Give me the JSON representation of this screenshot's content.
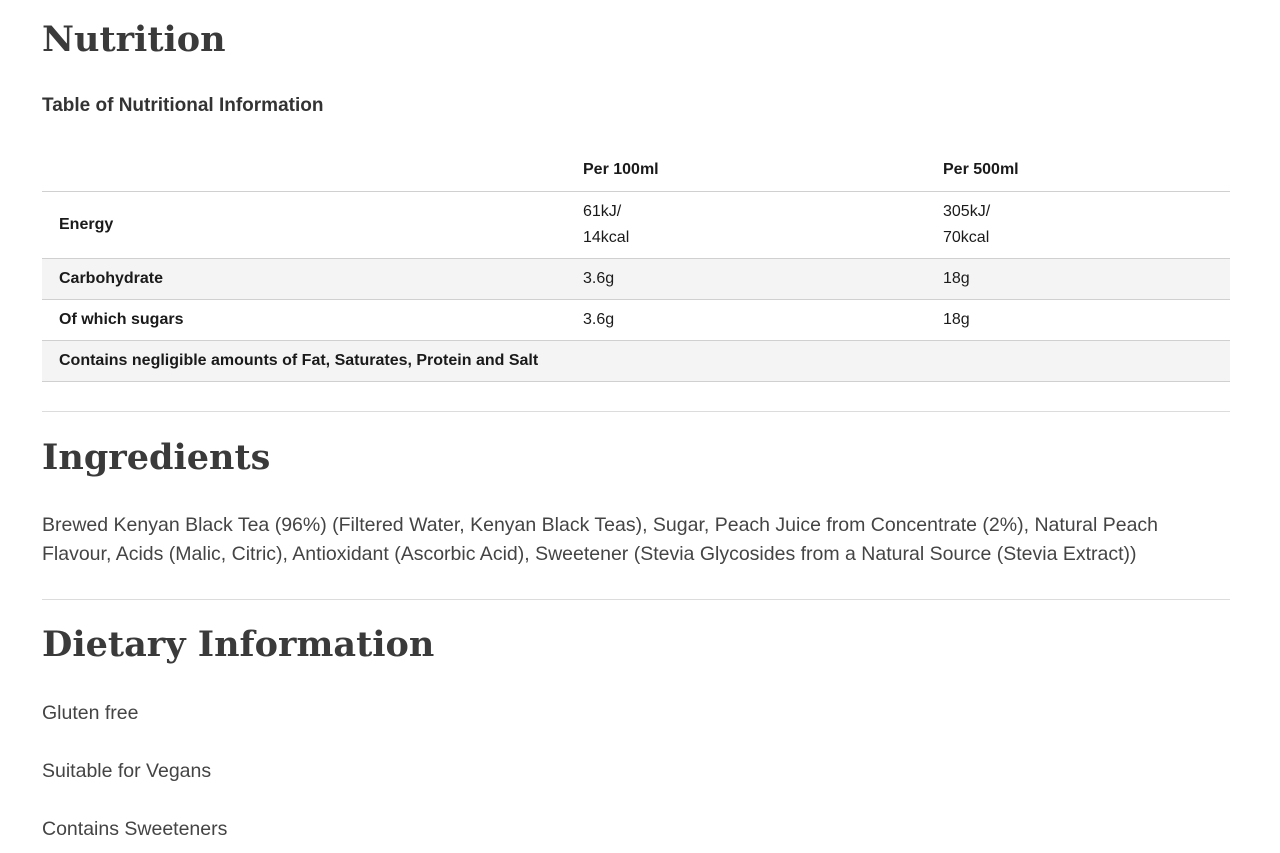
{
  "nutrition": {
    "heading": "Nutrition",
    "table_caption": "Table of Nutritional Information",
    "columns": [
      "",
      "Per 100ml",
      "Per 500ml"
    ],
    "rows": [
      {
        "label": "Energy",
        "per100_line1": "61kJ/",
        "per100_line2": "14kcal",
        "per500_line1": "305kJ/",
        "per500_line2": "70kcal"
      },
      {
        "label": "Carbohydrate",
        "per100": "3.6g",
        "per500": "18g"
      },
      {
        "label": "Of which sugars",
        "per100": "3.6g",
        "per500": "18g"
      }
    ],
    "footnote": "Contains negligible amounts of Fat, Saturates, Protein and Salt"
  },
  "ingredients": {
    "heading": "Ingredients",
    "text": "Brewed Kenyan Black Tea (96%) (Filtered Water, Kenyan Black Teas), Sugar, Peach Juice from Concentrate (2%), Natural Peach Flavour, Acids (Malic, Citric), Antioxidant (Ascorbic Acid), Sweetener (Stevia Glycosides from a Natural Source (Stevia Extract))"
  },
  "dietary": {
    "heading": "Dietary Information",
    "items": [
      "Gluten free",
      "Suitable for Vegans",
      "Contains Sweeteners"
    ]
  }
}
